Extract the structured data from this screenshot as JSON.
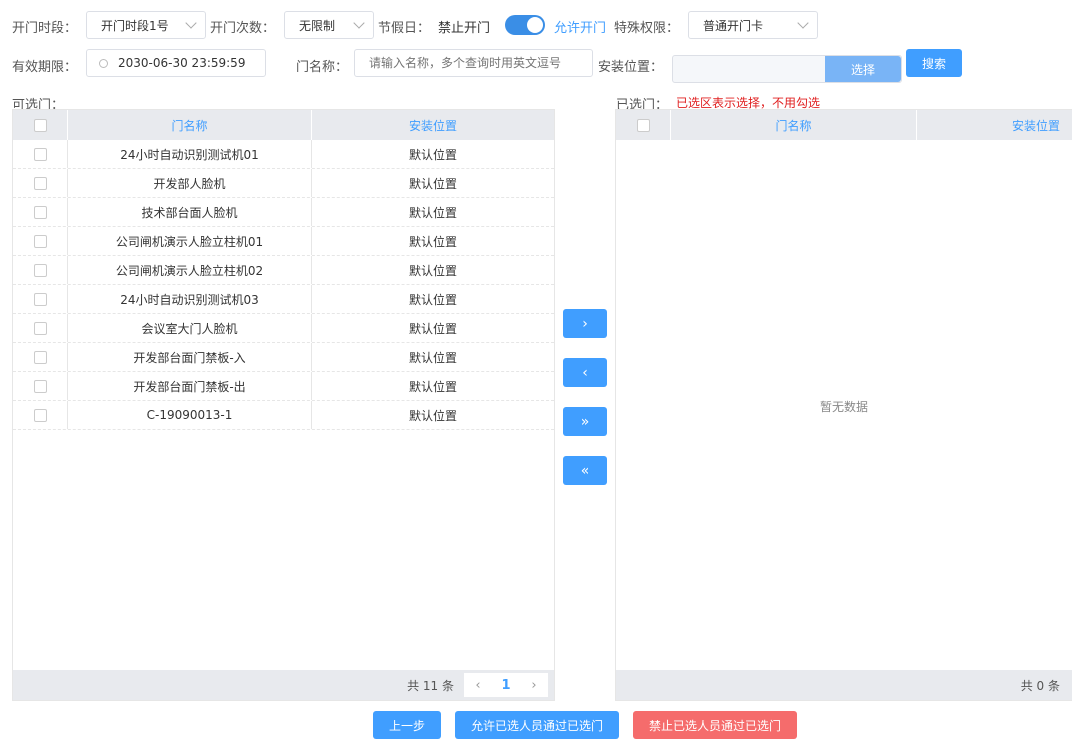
{
  "filters": {
    "period_label": "开门时段：",
    "period_value": "开门时段1号",
    "count_label": "开门次数：",
    "count_value": "无限制",
    "holiday_label": "节假日：",
    "holiday_off": "禁止开门",
    "holiday_on": "允许开门",
    "special_label": "特殊权限：",
    "special_value": "普通开门卡",
    "valid_label": "有效期限：",
    "valid_value": "2030-06-30 23:59:59",
    "door_label": "门名称：",
    "door_placeholder": "请输入名称，多个查询时用英文逗号",
    "location_label": "安装位置：",
    "location_select_btn": "选择",
    "search_btn": "搜索"
  },
  "left": {
    "title": "可选门：",
    "columns": [
      "门名称",
      "安装位置"
    ],
    "rows": [
      {
        "name": "24小时自动识别测试机01",
        "location": "默认位置"
      },
      {
        "name": "开发部人脸机",
        "location": "默认位置"
      },
      {
        "name": "技术部台面人脸机",
        "location": "默认位置"
      },
      {
        "name": "公司闸机演示人脸立柱机01",
        "location": "默认位置"
      },
      {
        "name": "公司闸机演示人脸立柱机02",
        "location": "默认位置"
      },
      {
        "name": "24小时自动识别测试机03",
        "location": "默认位置"
      },
      {
        "name": "会议室大门人脸机",
        "location": "默认位置"
      },
      {
        "name": "开发部台面门禁板-入",
        "location": "默认位置"
      },
      {
        "name": "开发部台面门禁板-出",
        "location": "默认位置"
      },
      {
        "name": "C-19090013-1",
        "location": "默认位置"
      }
    ],
    "total": "共 11 条",
    "page": "1"
  },
  "right": {
    "title": "已选门：",
    "hint": "已选区表示选择，不用勾选",
    "columns": [
      "门名称",
      "安装位置"
    ],
    "empty": "暂无数据",
    "total": "共 0 条"
  },
  "transfer": {
    "move_right": "›",
    "move_left": "‹",
    "move_all_right": "»",
    "move_all_left": "«"
  },
  "actions": {
    "prev": "上一步",
    "allow": "允许已选人员通过已选门",
    "deny": "禁止已选人员通过已选门"
  },
  "colors": {
    "primary": "#409eff",
    "danger": "#f56c6c",
    "hint": "#e02020"
  }
}
